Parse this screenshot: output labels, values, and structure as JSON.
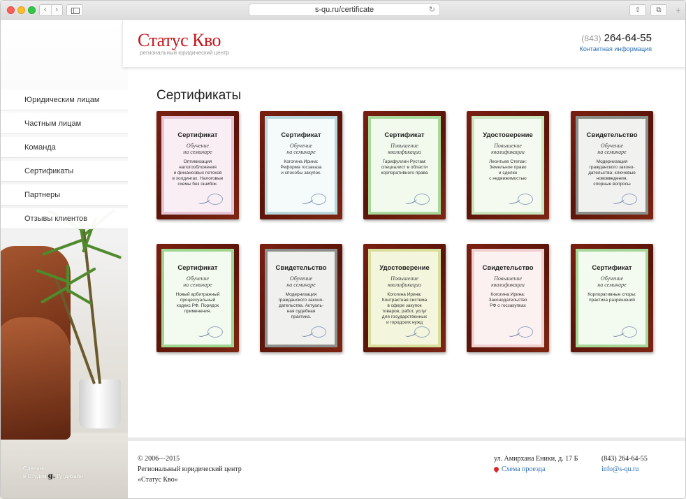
{
  "browser": {
    "url": "s-qu.ru/certificate",
    "back_icon": "‹",
    "forward_icon": "›",
    "reload_icon": "↻",
    "share_icon": "⇧",
    "tabs_icon": "⧉",
    "plus_icon": "+"
  },
  "header": {
    "logo_title": "Статус Кво",
    "logo_subtitle": "региональный юридический центр",
    "phone_code": "(843)",
    "phone_number": "264-64-55",
    "contact_link": "Контактная информация",
    "brand_color": "#c4161c"
  },
  "sidebar": {
    "items": [
      {
        "label": "Юридическим лицам"
      },
      {
        "label": "Частным лицам"
      },
      {
        "label": "Команда"
      },
      {
        "label": "Сертификаты"
      },
      {
        "label": "Партнеры"
      },
      {
        "label": "Отзывы клиентов"
      }
    ],
    "credit_line1": "Сделано",
    "credit_line2a": "в Студии",
    "credit_logo": "g.",
    "credit_line2b": "Гутдизайн"
  },
  "main": {
    "title": "Сертификаты",
    "certificates": [
      {
        "title": "Сертификат",
        "subtitle": "Обучение\nна семинаре",
        "body": "Оптимизация\nналогообложения\nи финансовых потоков\nв холдингах. Налоговые\nсхемы без ошибок.",
        "border_color": "#e6c6d6",
        "paper_color": "#f9eef4"
      },
      {
        "title": "Сертификат",
        "subtitle": "Обучение\nна семинаре",
        "body": "Когогина Ирина:\nРеформа госзаказа\nи способы закупок.",
        "border_color": "#b8d7dc",
        "paper_color": "#f5fafb"
      },
      {
        "title": "Сертификат",
        "subtitle": "Повышение\nквалификации",
        "body": "Гарифуллин Рустам:\nспециалист в области\nкорпоративного права",
        "border_color": "#a8d99a",
        "paper_color": "#f2faee"
      },
      {
        "title": "Удостоверение",
        "subtitle": "Повышение\nквалификации",
        "body": "Леонтьев Степан:\nЗемельное право\nи сделки\nс недвижимостью",
        "border_color": "#c9e6bf",
        "paper_color": "#f5faf1"
      },
      {
        "title": "Свидетельство",
        "subtitle": "Обучение\nна семинаре",
        "body": "Модернизация\nгражданского законо-\nдательства: ключевые\nнововведения,\nспорные вопросы",
        "border_color": "#8a8f8a",
        "paper_color": "#f1f1ef"
      },
      {
        "title": "Сертификат",
        "subtitle": "Обучение\nна семинаре",
        "body": "Новый арбитражный\nпроцессуальный\nкодекс РФ. Порядок\nприменения.",
        "border_color": "#9fd690",
        "paper_color": "#f3faef"
      },
      {
        "title": "Свидетельство",
        "subtitle": "Обучение\nна семинаре",
        "body": "Модернизация\nгражданского законо-\nдательства. Актуаль-\nная судебная\nпрактика.",
        "border_color": "#8d908c",
        "paper_color": "#f0f1ee"
      },
      {
        "title": "Удостоверение",
        "subtitle": "Повышение\nквалификации",
        "body": "Когогина Ирина:\nКонтрактная система\nв сфере закупок\nтоваров, работ, услуг\nдля государственных\nи городских нужд",
        "border_color": "#d8df9e",
        "paper_color": "#f3f6dc"
      },
      {
        "title": "Свидетельство",
        "subtitle": "Повышение\nквалификации",
        "body": "Когогина Ирина:\nЗаконодательство\nРФ о госзакупках",
        "border_color": "#f0cfcf",
        "paper_color": "#fbf1f0"
      },
      {
        "title": "Сертификат",
        "subtitle": "Обучение\nна семинаре",
        "body": "Корпоративные споры:\nпрактика разрешений",
        "border_color": "#a5d898",
        "paper_color": "#f3faef"
      }
    ]
  },
  "footer": {
    "copyright": "© 2006—2015",
    "org_line1": "Региональный юридический центр",
    "org_line2": "«Статус Кво»",
    "address": "ул. Амирхана Еники, д. 17 Б",
    "map_link": "Схема проезда",
    "phone": "(843) 264-64-55",
    "email": "info@s-qu.ru"
  }
}
